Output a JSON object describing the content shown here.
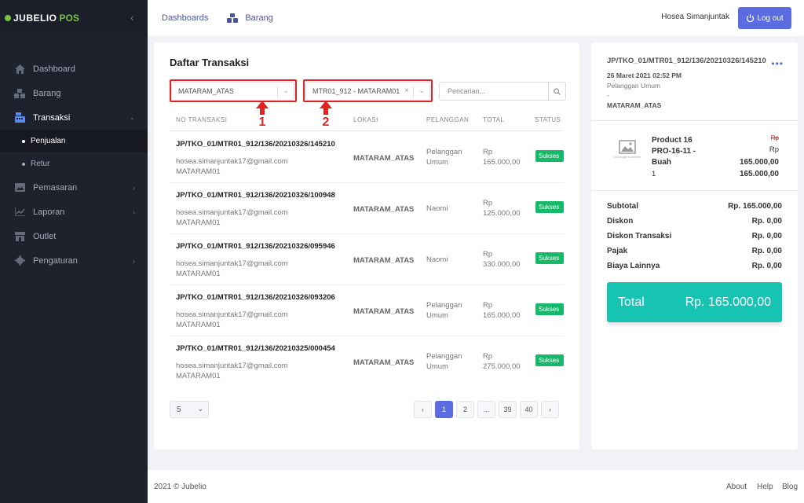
{
  "brand": {
    "name": "JUBELIO",
    "suffix": "POS"
  },
  "sidebar": {
    "items": [
      {
        "label": "Dashboard",
        "icon": "home-icon"
      },
      {
        "label": "Barang",
        "icon": "boxes-icon"
      },
      {
        "label": "Transaksi",
        "icon": "register-icon"
      },
      {
        "label": "Pemasaran",
        "icon": "image-icon"
      },
      {
        "label": "Laporan",
        "icon": "chart-icon"
      },
      {
        "label": "Outlet",
        "icon": "store-icon"
      },
      {
        "label": "Pengaturan",
        "icon": "gear-icon"
      }
    ],
    "subitems": [
      {
        "label": "Penjualan"
      },
      {
        "label": "Retur"
      }
    ]
  },
  "topbar": {
    "nav": [
      "Dashboards",
      "Barang"
    ],
    "user": "Hosea Simanjuntak",
    "logout": "Log out"
  },
  "list": {
    "title": "Daftar Transaksi",
    "filter_location": "MATARAM_ATAS",
    "filter_register": "MTR01_912 - MATARAM01",
    "search_placeholder": "Pencarian...",
    "annotations": [
      "1",
      "2"
    ],
    "columns": [
      "NO TRANSAKSI",
      "LOKASI",
      "PELANGGAN",
      "TOTAL",
      "STATUS"
    ],
    "rows": [
      {
        "no": "JP/TKO_01/MTR01_912/136/20210326/145210",
        "email": "hosea.simanjuntak17@gmail.com",
        "register": "MATARAM01",
        "lokasi": "MATARAM_ATAS",
        "pel1": "Pelanggan",
        "pel2": "Umum",
        "rp": "Rp",
        "total": "165.000,00",
        "status": "Sukses"
      },
      {
        "no": "JP/TKO_01/MTR01_912/136/20210326/100948",
        "email": "hosea.simanjuntak17@gmail.com",
        "register": "MATARAM01",
        "lokasi": "MATARAM_ATAS",
        "pel1": "Naomi",
        "pel2": "",
        "rp": "Rp",
        "total": "125.000,00",
        "status": "Sukses"
      },
      {
        "no": "JP/TKO_01/MTR01_912/136/20210326/095946",
        "email": "hosea.simanjuntak17@gmail.com",
        "register": "MATARAM01",
        "lokasi": "MATARAM_ATAS",
        "pel1": "Naomi",
        "pel2": "",
        "rp": "Rp",
        "total": "330.000,00",
        "status": "Sukses"
      },
      {
        "no": "JP/TKO_01/MTR01_912/136/20210326/093206",
        "email": "hosea.simanjuntak17@gmail.com",
        "register": "MATARAM01",
        "lokasi": "MATARAM_ATAS",
        "pel1": "Pelanggan",
        "pel2": "Umum",
        "rp": "Rp",
        "total": "165.000,00",
        "status": "Sukses"
      },
      {
        "no": "JP/TKO_01/MTR01_912/136/20210325/000454",
        "email": "hosea.simanjuntak17@gmail.com",
        "register": "MATARAM01",
        "lokasi": "MATARAM_ATAS",
        "pel1": "Pelanggan",
        "pel2": "Umum",
        "rp": "Rp",
        "total": "275.000,00",
        "status": "Sukses"
      }
    ],
    "per_page": "5",
    "pages": [
      "‹",
      "1",
      "2",
      "...",
      "39",
      "40",
      "›"
    ]
  },
  "detail": {
    "id": "JP/TKO_01/MTR01_912/136/20210326/145210",
    "date": "26 Maret 2021 02:52 PM",
    "customer": "Pelanggan Umum",
    "dash": "-",
    "location": "MATARAM_ATAS",
    "product": {
      "name": "Product 16 PRO-16-11 - Buah",
      "qty": "1",
      "strike": "Rp",
      "rp": "Rp",
      "price": "165.000,00",
      "subtotal": "165.000,00",
      "no_image": "No Image Available"
    },
    "summary": [
      {
        "label": "Subtotal",
        "value": "Rp. 165.000,00"
      },
      {
        "label": "Diskon",
        "value": "Rp. 0,00"
      },
      {
        "label": "Diskon Transaksi",
        "value": "Rp. 0,00"
      },
      {
        "label": "Pajak",
        "value": "Rp. 0,00"
      },
      {
        "label": "Biaya Lainnya",
        "value": "Rp. 0,00"
      }
    ],
    "total_label": "Total",
    "total_value": "Rp. 165.000,00"
  },
  "footer": {
    "copyright": "2021 © Jubelio",
    "links": [
      "About",
      "Help",
      "Blog"
    ]
  }
}
